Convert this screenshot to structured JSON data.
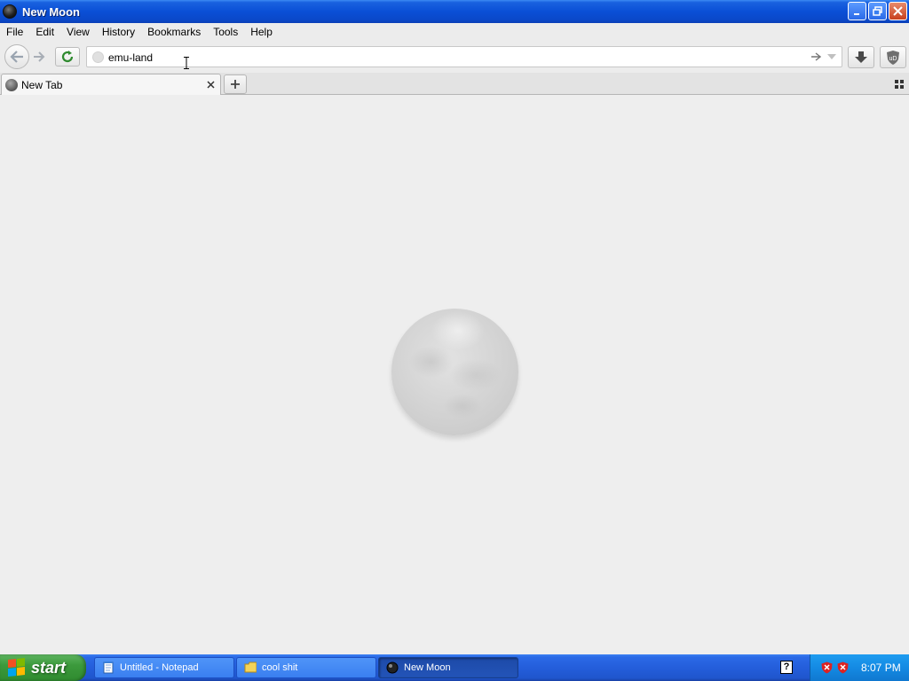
{
  "window": {
    "title": "New Moon"
  },
  "menu": [
    "File",
    "Edit",
    "View",
    "History",
    "Bookmarks",
    "Tools",
    "Help"
  ],
  "navbar": {
    "url_value": "emu-land"
  },
  "tabs": [
    {
      "label": "New Tab"
    }
  ],
  "taskbar": {
    "start_label": "start",
    "buttons": [
      {
        "label": "Untitled - Notepad",
        "icon": "notepad-icon"
      },
      {
        "label": "cool shit",
        "icon": "folder-icon"
      },
      {
        "label": "New Moon",
        "icon": "new-moon-icon",
        "active": true
      }
    ],
    "help_glyph": "?",
    "clock": "8:07 PM"
  },
  "colors": {
    "titlebar": "#0a4fd6",
    "taskbar": "#245edb",
    "start": "#3c9a3c",
    "tray": "#148ae3",
    "content_bg": "#eeeeee"
  }
}
